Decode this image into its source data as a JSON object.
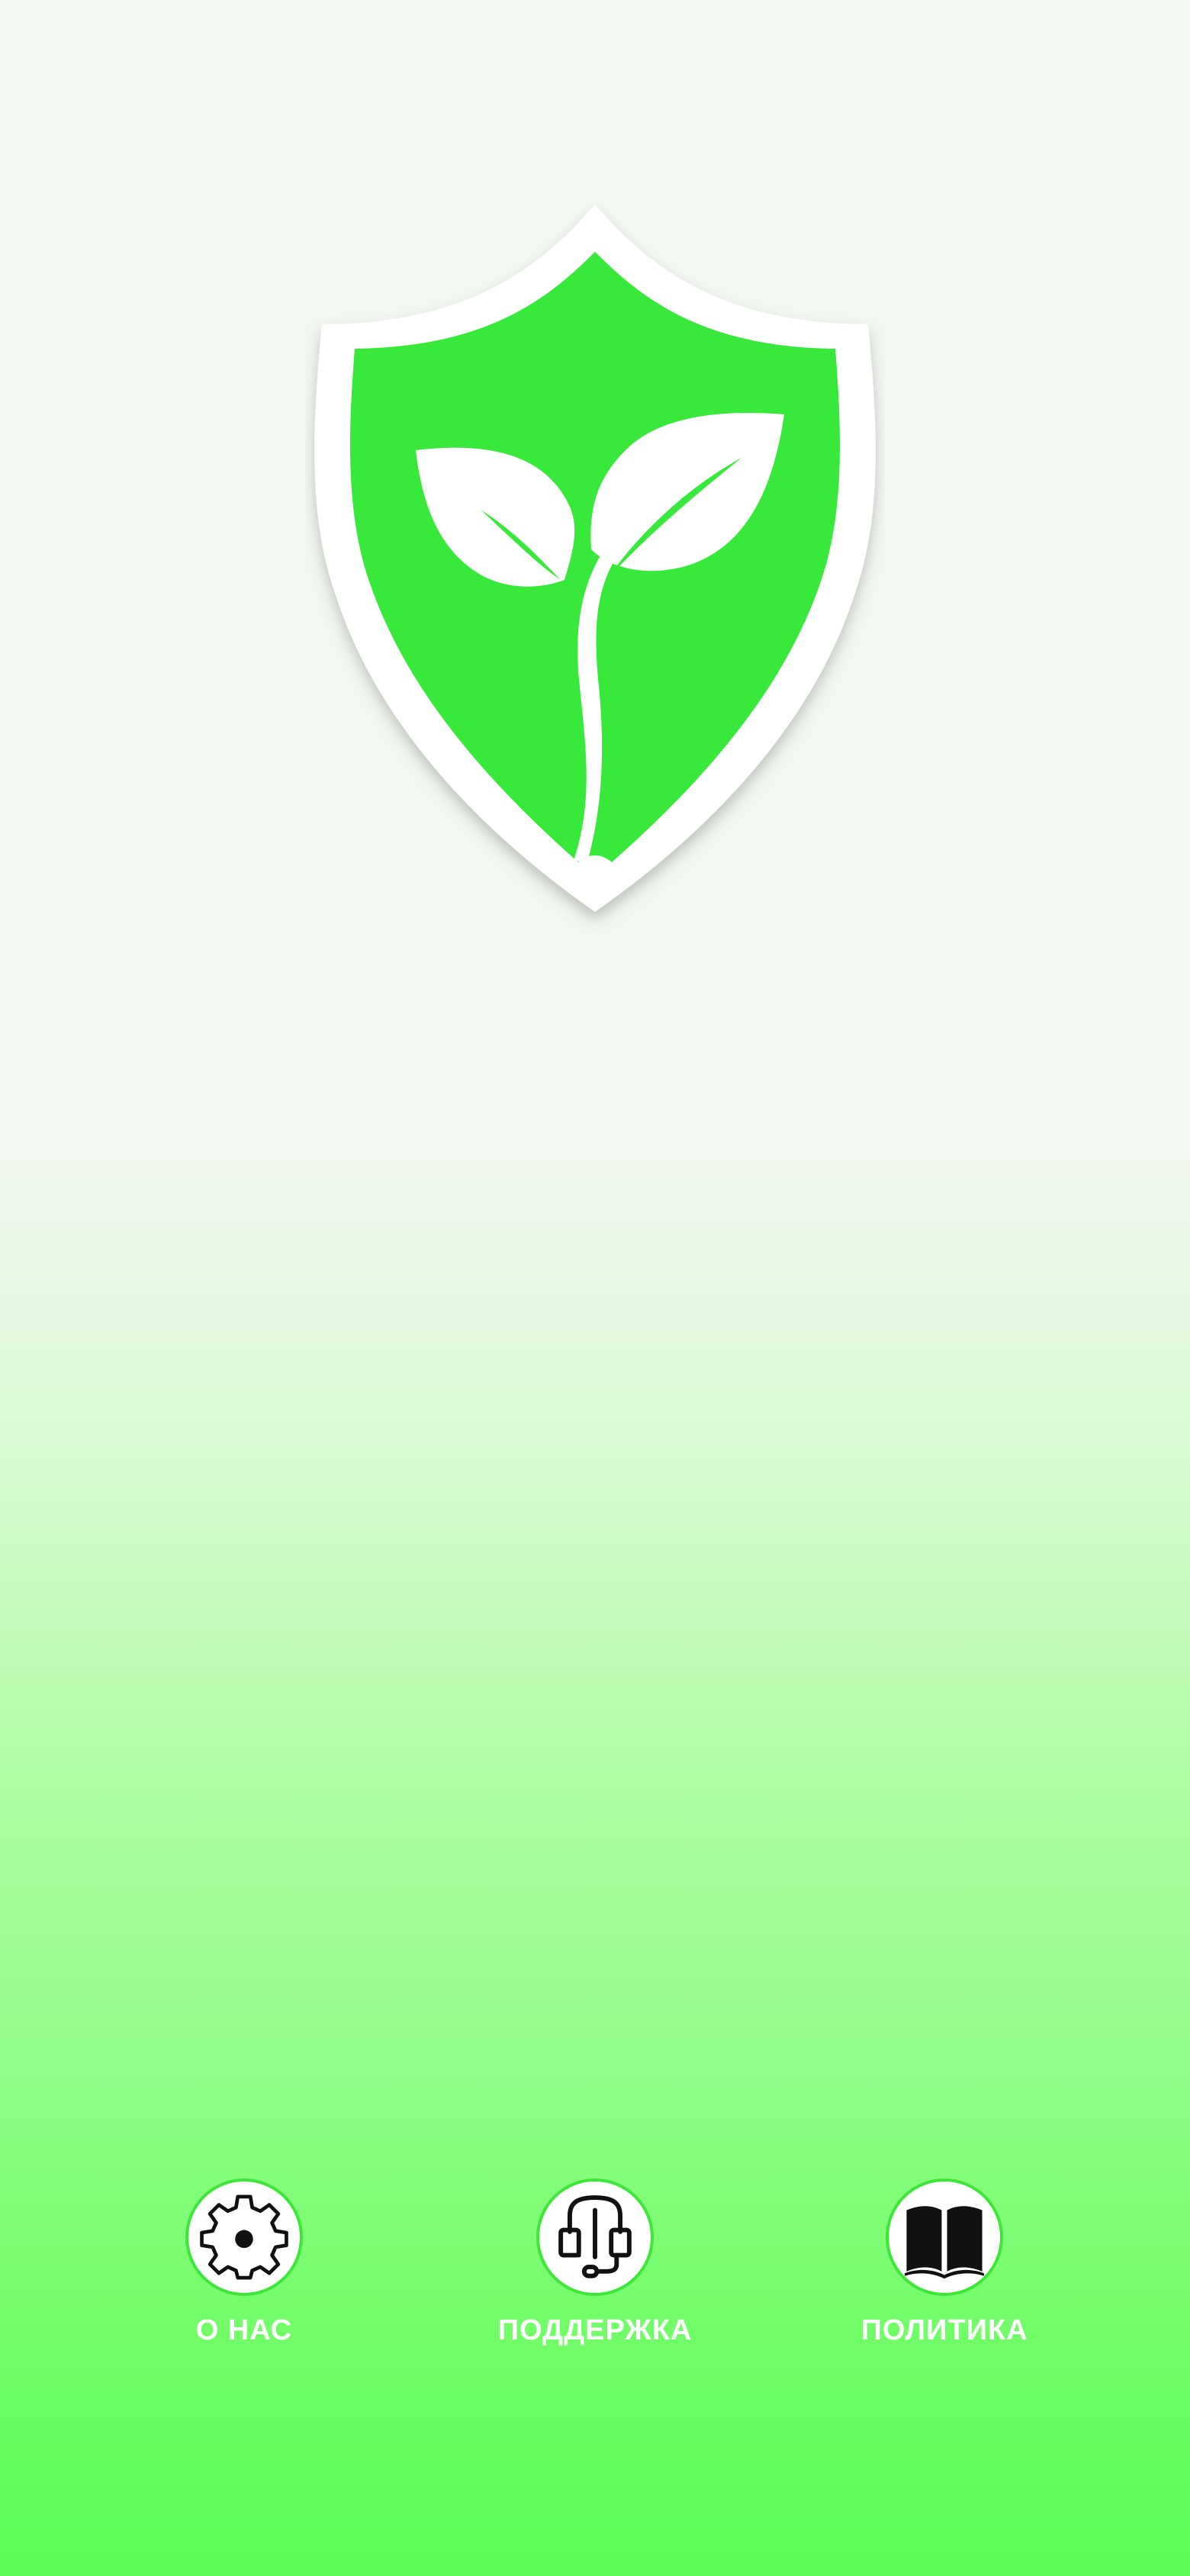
{
  "theme": {
    "accent": "#38e83a",
    "label_color": "#ffffff",
    "background_top": "#f3f8f2",
    "background_bottom": "#5dfd54"
  },
  "logo": {
    "icon": "shield-sprout-icon"
  },
  "bottom_nav": {
    "items": [
      {
        "label": "О НАС",
        "icon": "gear-icon"
      },
      {
        "label": "ПОДДЕРЖКА",
        "icon": "headset-support-icon"
      },
      {
        "label": "ПОЛИТИКА",
        "icon": "open-book-icon"
      }
    ]
  }
}
